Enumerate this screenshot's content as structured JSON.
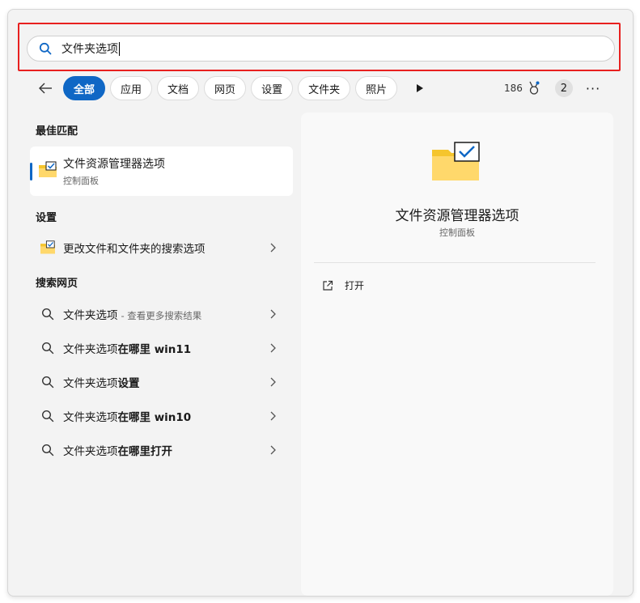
{
  "search": {
    "query": "文件夹选项"
  },
  "filters": {
    "items": [
      "全部",
      "应用",
      "文档",
      "网页",
      "设置",
      "文件夹",
      "照片"
    ],
    "active_index": 0
  },
  "toolbar": {
    "points": "186",
    "badge_count": "2",
    "more": "···"
  },
  "best_match": {
    "section": "最佳匹配",
    "title": "文件资源管理器选项",
    "subtitle": "控制面板"
  },
  "settings": {
    "section": "设置",
    "items": [
      {
        "label": "更改文件和文件夹的搜索选项"
      }
    ]
  },
  "web": {
    "section": "搜索网页",
    "items": [
      {
        "prefix": "文件夹选项",
        "bold": "",
        "sub": "- 查看更多搜索结果"
      },
      {
        "prefix": "文件夹选项",
        "bold": "在哪里 win11",
        "sub": ""
      },
      {
        "prefix": "文件夹选项",
        "bold": "设置",
        "sub": ""
      },
      {
        "prefix": "文件夹选项",
        "bold": "在哪里 win10",
        "sub": ""
      },
      {
        "prefix": "文件夹选项",
        "bold": "在哪里打开",
        "sub": ""
      }
    ]
  },
  "preview": {
    "title": "文件资源管理器选项",
    "subtitle": "控制面板",
    "actions": [
      {
        "label": "打开",
        "icon": "open-external-icon"
      }
    ]
  },
  "colors": {
    "accent": "#0f67c5",
    "highlight": "#e8201f",
    "folder": "#f5c52d"
  }
}
